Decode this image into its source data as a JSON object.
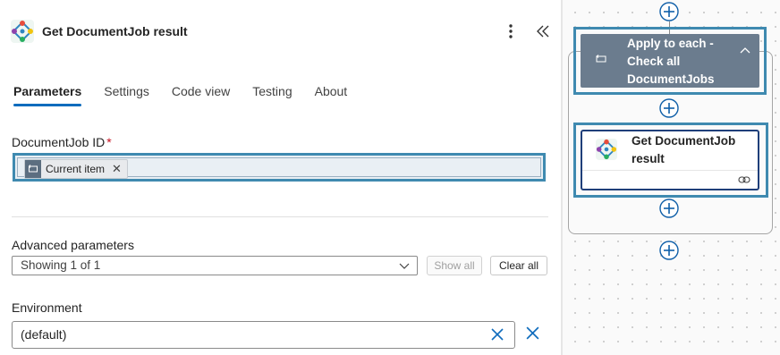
{
  "panel": {
    "title": "Get DocumentJob result",
    "tabs": [
      "Parameters",
      "Settings",
      "Code view",
      "Testing",
      "About"
    ],
    "active_tab": "Parameters",
    "documentjob_field": {
      "label": "DocumentJob ID",
      "required_mark": "*",
      "token_label": "Current item",
      "token_close": "✕"
    },
    "advanced": {
      "label": "Advanced parameters",
      "selected": "Showing 1 of 1",
      "show_all_label": "Show all",
      "clear_all_label": "Clear all"
    },
    "environment": {
      "label": "Environment",
      "value": "(default)"
    }
  },
  "canvas": {
    "apply_to_each_title": "Apply to each - Check all DocumentJobs",
    "get_result_title": "Get DocumentJob result"
  },
  "colors": {
    "accent": "#0f6cbd",
    "highlight": "#3f8ab0",
    "apply_card": "#6b7c8e",
    "required": "#c50f1f"
  },
  "icons": {
    "header": "connector-logo-icon",
    "more": "more-vertical-icon",
    "collapse": "double-chevron-left-icon",
    "token": "loop-icon",
    "select": "chevron-down-icon",
    "env_clear": "close-icon",
    "apply": "loop-icon",
    "apply_toggle": "chevron-up-icon",
    "get": "connector-logo-icon",
    "link": "link-icon",
    "add": "plus-circle-icon"
  }
}
